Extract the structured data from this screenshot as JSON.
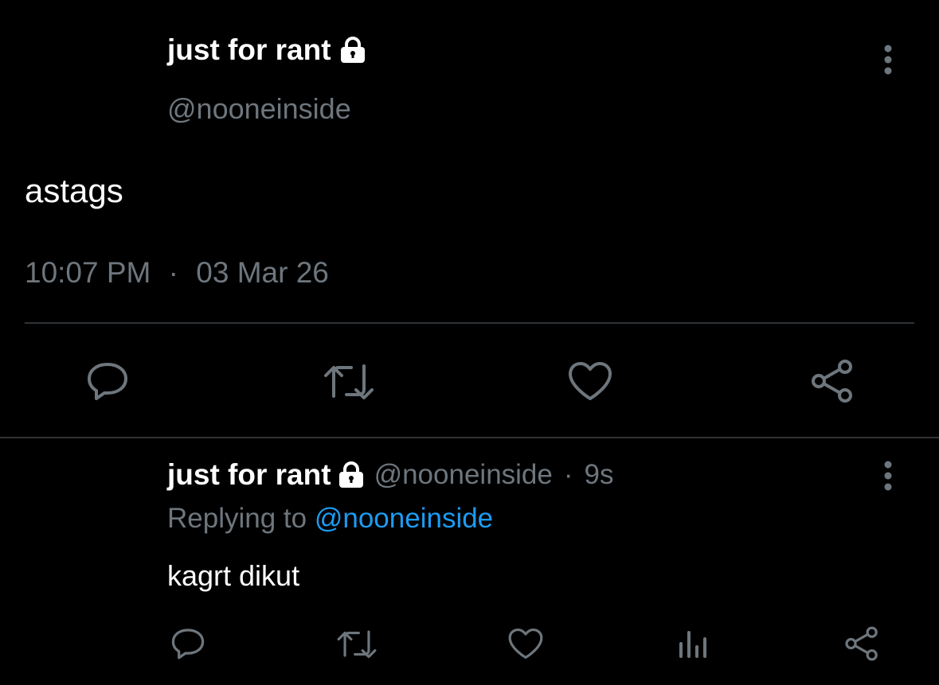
{
  "main_tweet": {
    "display_name": "just for rant",
    "lock_icon": "lock-icon",
    "handle": "@nooneinside",
    "text": "astags",
    "time": "10:07 PM",
    "date_separator": "·",
    "date": "03 Mar 26",
    "actions": [
      "reply-icon",
      "retweet-icon",
      "like-icon",
      "share-icon"
    ]
  },
  "reply_tweet": {
    "display_name": "just for rant",
    "handle": "@nooneinside",
    "separator": "·",
    "time_ago": "9s",
    "replying_prefix": "Replying to",
    "replying_handle": "@nooneinside",
    "text": "kagrt dikut",
    "actions": [
      "reply-icon",
      "retweet-icon",
      "like-icon",
      "views-icon",
      "share-icon"
    ]
  },
  "colors": {
    "background": "#000000",
    "text_primary": "#ffffff",
    "text_secondary": "#6e767d",
    "link": "#1d9bf0",
    "divider": "#2f3336"
  }
}
